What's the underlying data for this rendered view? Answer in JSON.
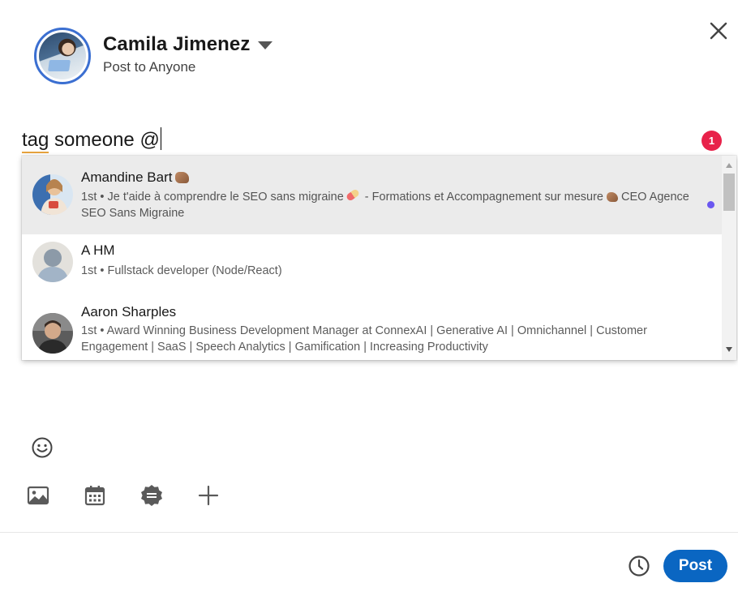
{
  "author": {
    "name": "Camila Jimenez",
    "visibility": "Post to Anyone"
  },
  "editor": {
    "text_tagged": "tag",
    "text_rest": " someone @"
  },
  "notification_count": "1",
  "mentions": [
    {
      "name": "Amandine Bart",
      "degree": "1st",
      "desc_part1": " • Je t'aide à comprendre le SEO sans migraine",
      "desc_part2": " - Formations et Accompagnement sur mesure",
      "desc_part3": " CEO Agence SEO Sans Migraine"
    },
    {
      "name": "A HM",
      "degree": "1st",
      "desc": " • Fullstack developer (Node/React)"
    },
    {
      "name": "Aaron Sharples",
      "degree": "1st",
      "desc": " • Award Winning Business Development Manager at ConnexAI | Generative AI | Omnichannel | Customer Engagement | SaaS | Speech Analytics | Gamification | Increasing Productivity"
    }
  ],
  "footer": {
    "post_label": "Post"
  },
  "icons": {
    "close": "close-icon",
    "emoji": "smiley-icon",
    "media": "image-icon",
    "event": "calendar-icon",
    "celebrate": "badge-icon",
    "more": "plus-icon",
    "schedule": "clock-icon"
  },
  "colors": {
    "primary": "#0a66c2",
    "badge": "#e8224a",
    "unread": "#6a57f0",
    "tag_underline": "#e7a33e"
  }
}
